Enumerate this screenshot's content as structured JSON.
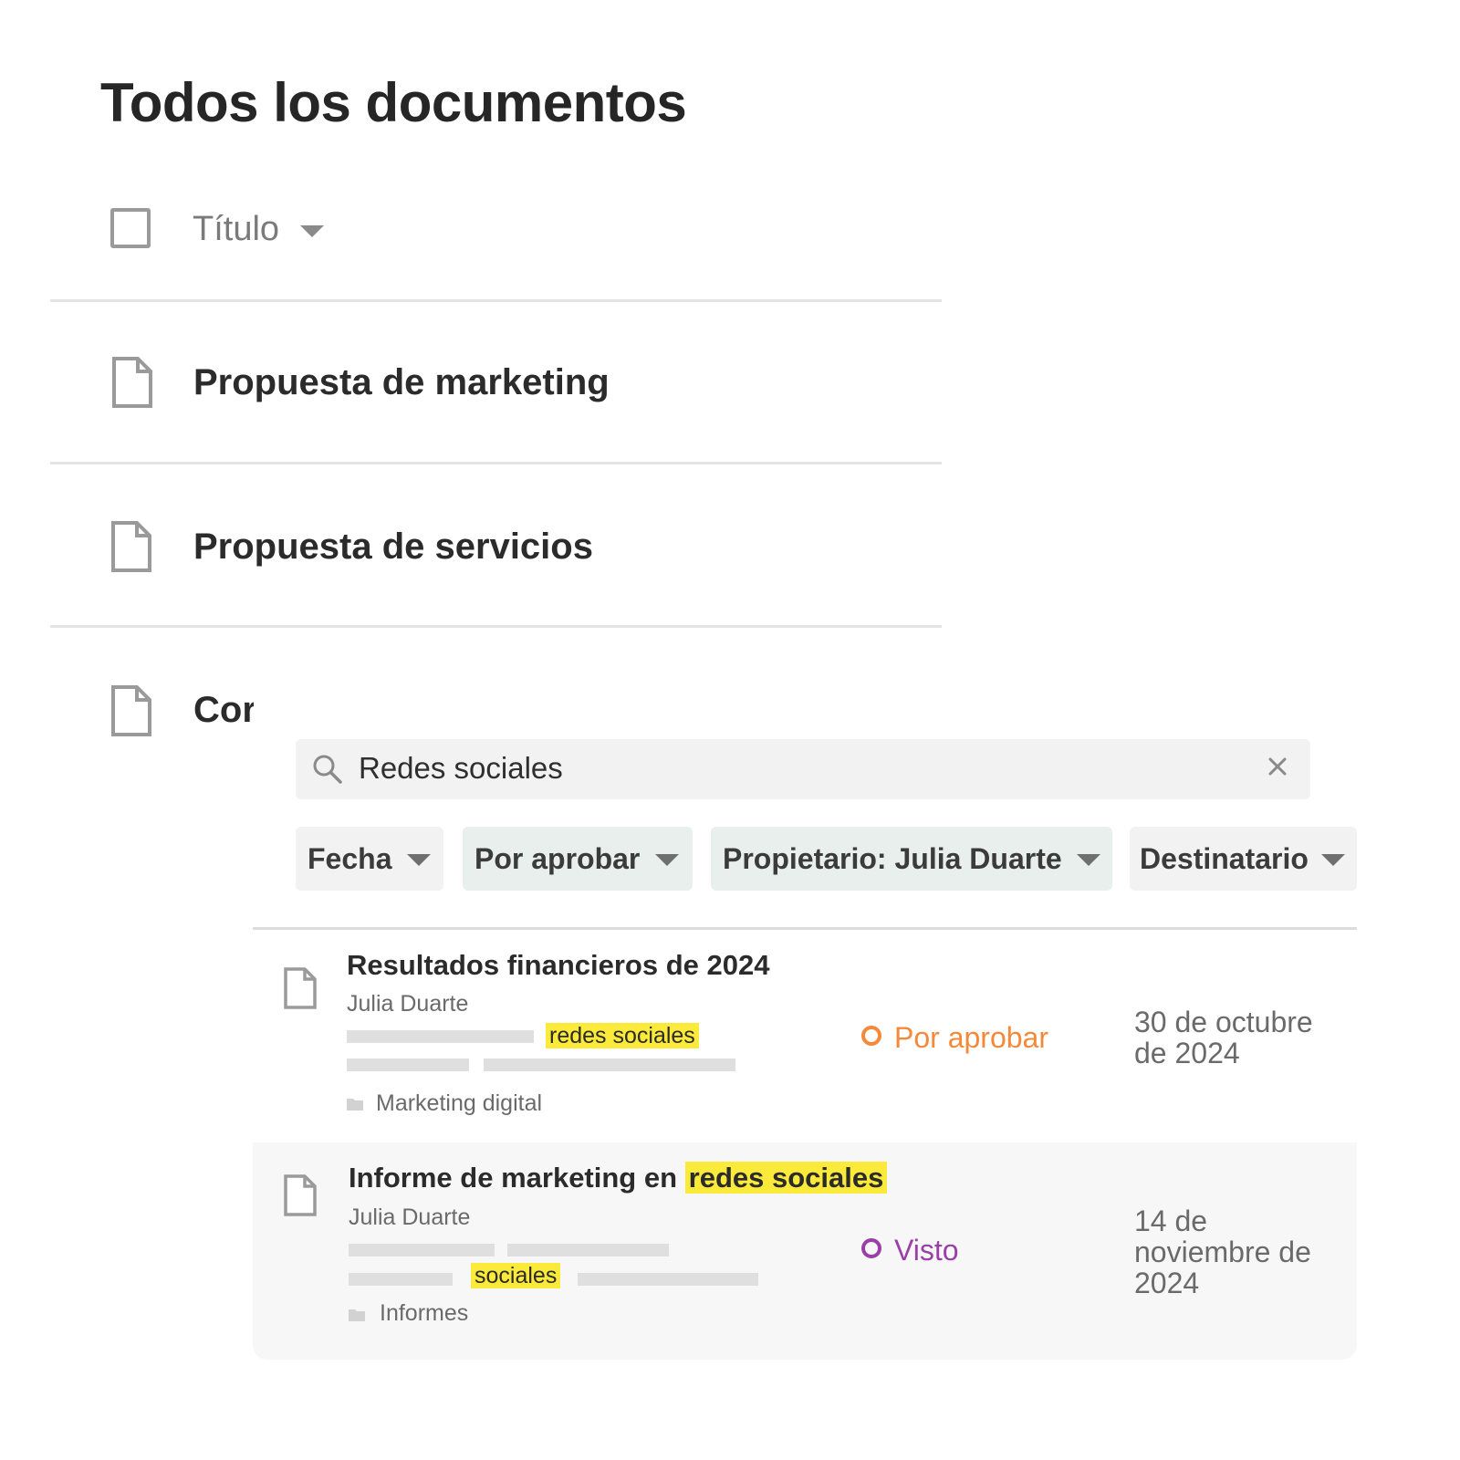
{
  "page_title": "Todos los documentos",
  "list_header": {
    "column_label": "Título"
  },
  "documents": [
    {
      "title": "Propuesta de marketing"
    },
    {
      "title": "Propuesta de servicios"
    },
    {
      "title": "Cor"
    }
  ],
  "search": {
    "query": "Redes sociales"
  },
  "filters": [
    {
      "label": "Fecha"
    },
    {
      "label": "Por aprobar"
    },
    {
      "label": "Propietario: Julia Duarte"
    },
    {
      "label": "Destinatario"
    }
  ],
  "results": [
    {
      "title": "Resultados financieros de 2024",
      "owner": "Julia Duarte",
      "snippet_highlight": "redes sociales",
      "folder": "Marketing digital",
      "status": "Por aprobar",
      "status_color": "#f5893a",
      "date": "30 de octubre de 2024"
    },
    {
      "title_prefix": "Informe de marketing en",
      "title_highlight": "redes sociales",
      "owner": "Julia Duarte",
      "snippet_highlight": "sociales",
      "folder": "Informes",
      "status": "Visto",
      "status_color": "#9b3fa8",
      "date": "14 de noviembre de 2024"
    }
  ],
  "colors": {
    "highlight": "#fbea3a",
    "teal_chip": "#e8efed",
    "gray_chip": "#f2f2f2"
  }
}
